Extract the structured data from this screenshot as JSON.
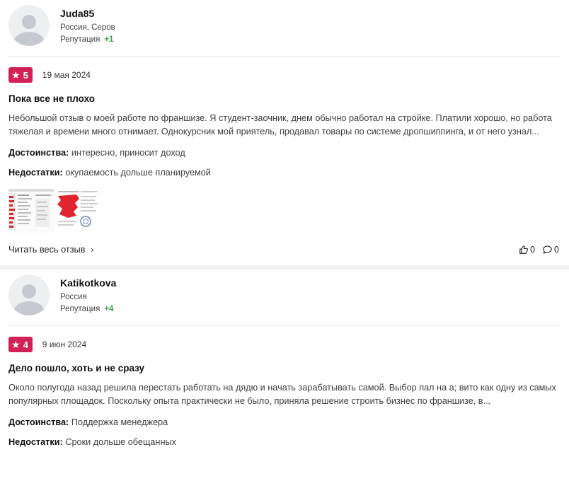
{
  "reviews": [
    {
      "user": {
        "name": "Juda85",
        "location": "Россия, Серов",
        "reputation_label": "Репутация",
        "reputation_value": "+1"
      },
      "rating": "5",
      "date": "19 мая 2024",
      "title": "Пока все не плохо",
      "text": "Небольшой отзыв о моей работе по франшизе. Я студент-заочник, днем обычно работал на стройке. Платили хорошо, но работа тяжелая и времени много отнимает. Однокурсник мой приятель, продавал товары по системе дропшиппинга, и от него узнал...",
      "pros_label": "Достоинства:",
      "pros": "интересно, приносит доход",
      "cons_label": "Недостатки:",
      "cons": "окупаемость дольше планируемой",
      "read_more": "Читать весь отзыв",
      "likes": "0",
      "comments": "0"
    },
    {
      "user": {
        "name": "Katikotkova",
        "location": "Россия",
        "reputation_label": "Репутация",
        "reputation_value": "+4"
      },
      "rating": "4",
      "date": "9 июн 2024",
      "title": "Дело пошло, хоть и не сразу",
      "text": "Около полугода назад решила перестать работать на дядю и начать зарабатывать самой. Выбор пал на а; вито как одну из самых популярных площадок. Поскольку опыта практически не было, приняла решение строить бизнес по франшизе, в...",
      "pros_label": "Достоинства:",
      "pros": "Поддержка менеджера",
      "cons_label": "Недостатки:",
      "cons": "Сроки дольше обещанных"
    }
  ],
  "colors": {
    "rating_badge": "#d42155",
    "reputation_plus": "#3aa241"
  },
  "icons": {
    "rating": "star-icon",
    "like": "thumbs-up-icon",
    "comment": "comment-icon",
    "read_more": "chevron-right-icon"
  }
}
